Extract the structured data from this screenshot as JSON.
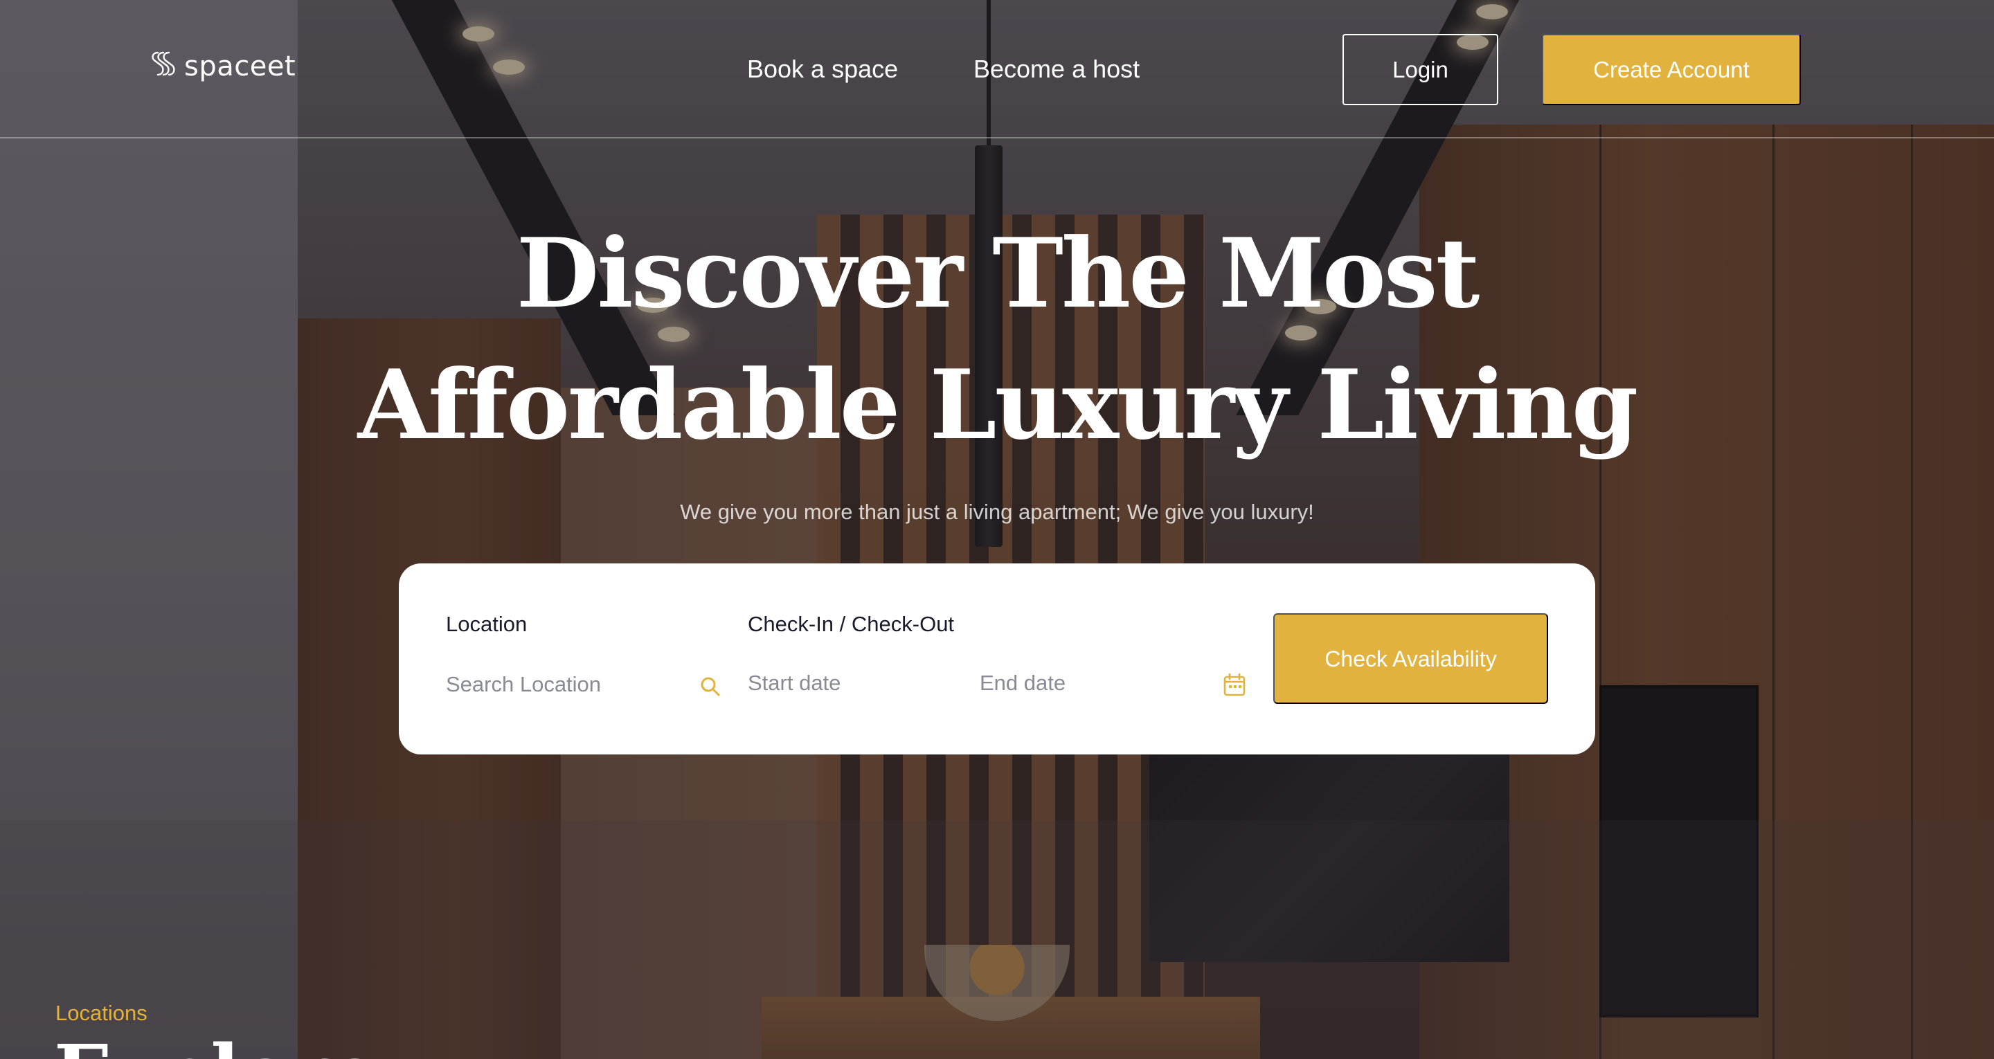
{
  "colors": {
    "accent": "#e2b23e",
    "text_dark": "#1b1a2a",
    "white": "#ffffff"
  },
  "header": {
    "logo_text": "spaceet",
    "logo_icon": "spaceet-logo-icon",
    "nav": {
      "book": "Book a space",
      "host": "Become a host"
    },
    "login_label": "Login",
    "create_account_label": "Create Account"
  },
  "hero": {
    "title_line1": "Discover The Most",
    "title_line2": "Affordable Luxury Living",
    "subtitle": "We give you more than just a living apartment; We give you luxury!"
  },
  "search": {
    "location_label": "Location",
    "location_placeholder": "Search Location",
    "search_icon": "search-icon",
    "dates_label": "Check-In / Check-Out",
    "start_placeholder": "Start date",
    "end_placeholder": "End date",
    "calendar_icon": "calendar-icon",
    "submit_label": "Check Availability"
  },
  "section": {
    "eyebrow": "Locations",
    "title_peek": "Explore"
  }
}
